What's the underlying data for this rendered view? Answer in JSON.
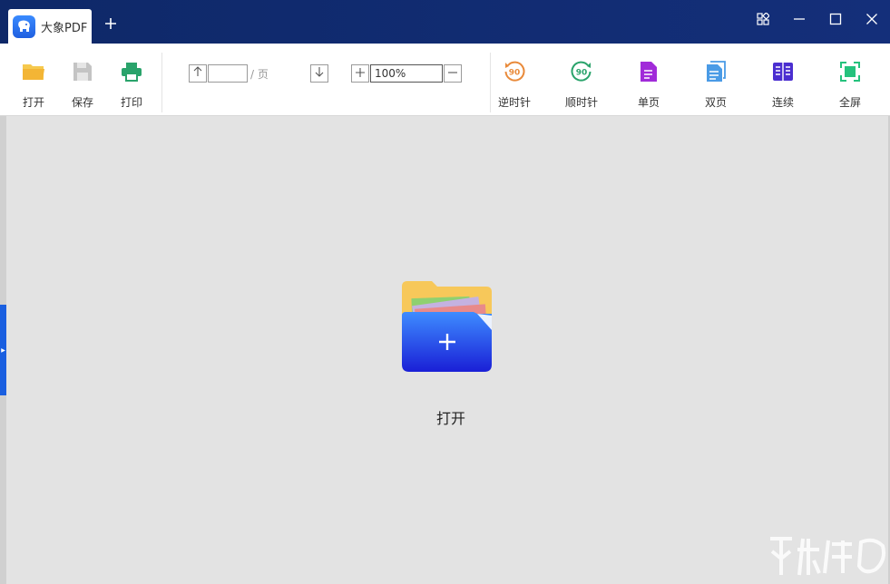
{
  "titlebar": {
    "app_title": "大象PDF",
    "new_tab_icon": "plus-icon",
    "controls": [
      "apps-icon",
      "minimize-icon",
      "maximize-icon",
      "close-icon"
    ]
  },
  "toolbar": {
    "open": {
      "label": "打开",
      "icon": "folder-icon",
      "color": "#f3b535"
    },
    "save": {
      "label": "保存",
      "icon": "save-icon",
      "color": "#bdbdbd"
    },
    "print": {
      "label": "打印",
      "icon": "printer-icon",
      "color": "#2aa36b"
    },
    "page_nav": {
      "page_value": "",
      "page_suffix": "/ 页"
    },
    "zoom": {
      "value": "100%"
    },
    "rotate_ccw": {
      "label": "逆时针",
      "badge": "90",
      "color": "#e98a3a"
    },
    "rotate_cw": {
      "label": "顺时针",
      "badge": "90",
      "color": "#2aa36b"
    },
    "single_page": {
      "label": "单页",
      "color": "#a12bd9"
    },
    "double_page": {
      "label": "双页",
      "color": "#4a9be6"
    },
    "continuous": {
      "label": "连续",
      "color": "#4b2fd0"
    },
    "fullscreen": {
      "label": "全屏",
      "color": "#25c27d"
    }
  },
  "main": {
    "open_label": "打开"
  },
  "colors": {
    "titlebar_bg": "#0f2a6e",
    "accent": "#1a5fe0",
    "canvas_bg": "#e3e3e3"
  }
}
